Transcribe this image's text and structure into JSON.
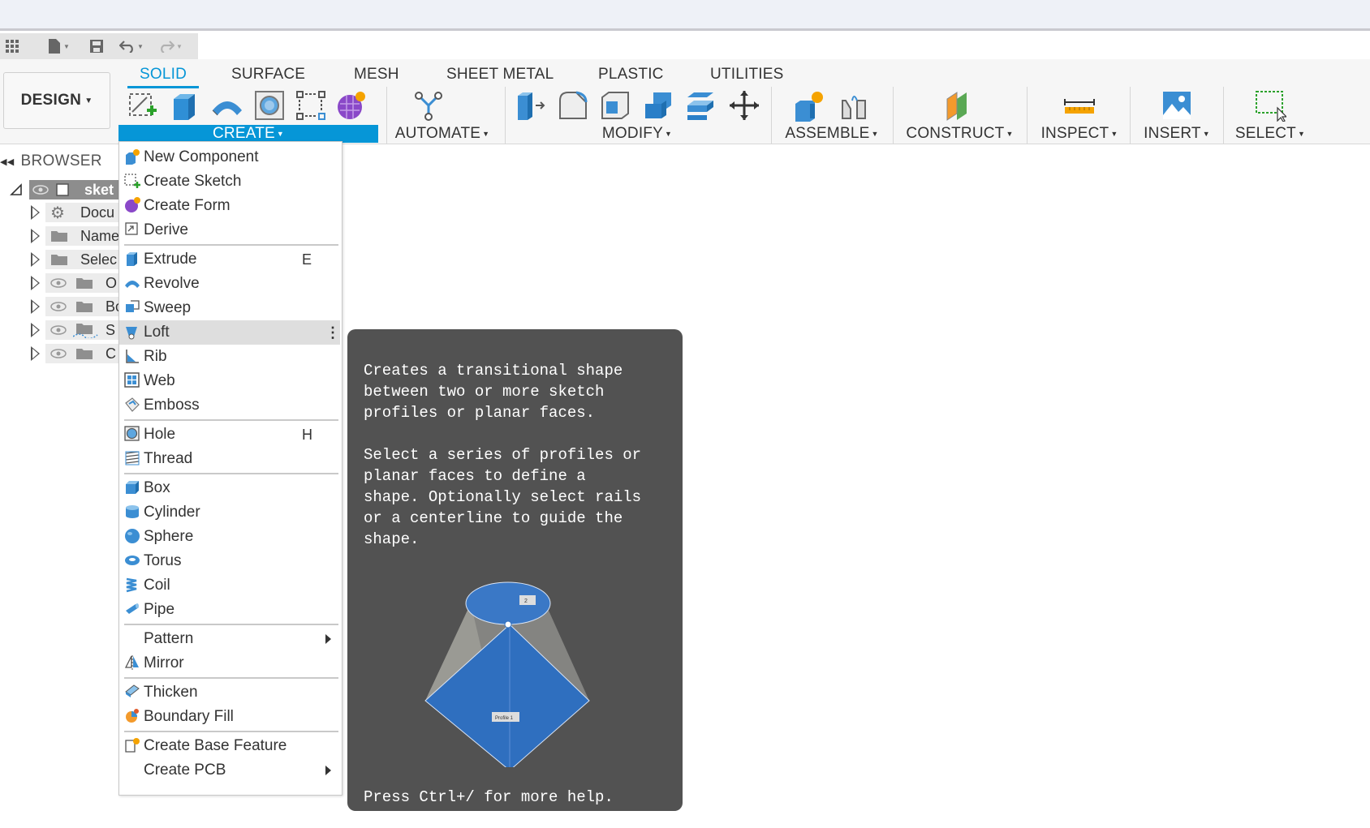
{
  "quick_access": {
    "items": [
      "grid-icon",
      "file-icon",
      "save-icon",
      "undo-icon",
      "redo-icon"
    ]
  },
  "ribbon": {
    "workspace": "DESIGN",
    "tabs": [
      "SOLID",
      "SURFACE",
      "MESH",
      "SHEET METAL",
      "PLASTIC",
      "UTILITIES"
    ],
    "active_tab": "SOLID",
    "groups": {
      "create": "CREATE",
      "automate": "AUTOMATE",
      "modify": "MODIFY",
      "assemble": "ASSEMBLE",
      "construct": "CONSTRUCT",
      "inspect": "INSPECT",
      "insert": "INSERT",
      "select": "SELECT"
    },
    "accent_color": "#0696d7"
  },
  "browser": {
    "title": "BROWSER",
    "rows": [
      {
        "label": "sket"
      },
      {
        "label": "Docu"
      },
      {
        "label": "Name"
      },
      {
        "label": "Selec"
      },
      {
        "label": "O"
      },
      {
        "label": "Bo"
      },
      {
        "label": "S"
      },
      {
        "label": "C"
      }
    ]
  },
  "create_menu": {
    "items": [
      {
        "label": "New Component",
        "icon": "new-component-icon"
      },
      {
        "label": "Create Sketch",
        "icon": "create-sketch-icon"
      },
      {
        "label": "Create Form",
        "icon": "create-form-icon"
      },
      {
        "label": "Derive",
        "icon": "derive-icon"
      },
      {
        "label": "Extrude",
        "icon": "extrude-icon",
        "shortcut": "E"
      },
      {
        "label": "Revolve",
        "icon": "revolve-icon"
      },
      {
        "label": "Sweep",
        "icon": "sweep-icon"
      },
      {
        "label": "Loft",
        "icon": "loft-icon"
      },
      {
        "label": "Rib",
        "icon": "rib-icon"
      },
      {
        "label": "Web",
        "icon": "web-icon"
      },
      {
        "label": "Emboss",
        "icon": "emboss-icon"
      },
      {
        "label": "Hole",
        "icon": "hole-icon",
        "shortcut": "H"
      },
      {
        "label": "Thread",
        "icon": "thread-icon"
      },
      {
        "label": "Box",
        "icon": "box-icon"
      },
      {
        "label": "Cylinder",
        "icon": "cylinder-icon"
      },
      {
        "label": "Sphere",
        "icon": "sphere-icon"
      },
      {
        "label": "Torus",
        "icon": "torus-icon"
      },
      {
        "label": "Coil",
        "icon": "coil-icon"
      },
      {
        "label": "Pipe",
        "icon": "pipe-icon"
      },
      {
        "label": "Pattern"
      },
      {
        "label": "Mirror",
        "icon": "mirror-icon"
      },
      {
        "label": "Thicken",
        "icon": "thicken-icon"
      },
      {
        "label": "Boundary Fill",
        "icon": "boundary-fill-icon"
      },
      {
        "label": "Create Base Feature",
        "icon": "base-feature-icon"
      },
      {
        "label": "Create PCB"
      }
    ],
    "highlighted": "Loft"
  },
  "tooltip": {
    "description": "Creates a transitional shape\nbetween two or more sketch\nprofiles or planar faces.\n\nSelect a series of profiles or\nplanar faces to define a\nshape. Optionally select rails\nor a centerline to guide the\nshape.",
    "footer": "Press Ctrl+/ for more help.",
    "image_labels": {
      "top": "2",
      "bottom": "Profile 1"
    }
  }
}
